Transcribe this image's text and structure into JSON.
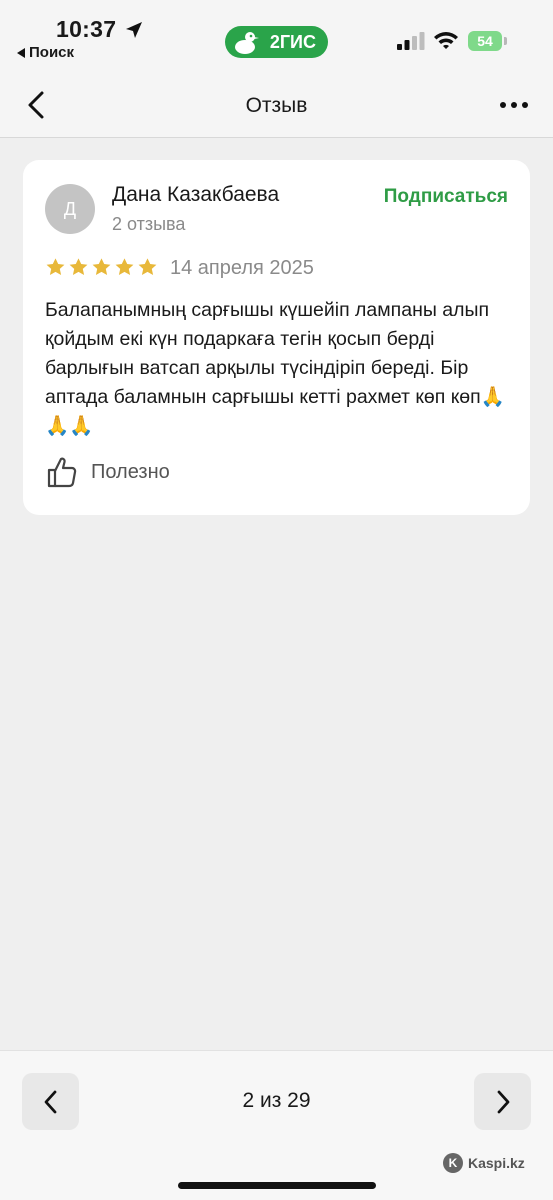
{
  "status_bar": {
    "time": "10:37",
    "back_app": "Поиск",
    "brand": "2ГИС",
    "battery": "54"
  },
  "nav": {
    "title": "Отзыв"
  },
  "review": {
    "avatar_letter": "Д",
    "author": "Дана Казакбаева",
    "review_count": "2 отзыва",
    "subscribe_label": "Подписаться",
    "rating": 5,
    "date": "14 апреля 2025",
    "text": "Балапанымның сарғышы күшейіп лампаны алып қойдым екі күн подаркаға тегін қосып берді барлығын ватсап арқылы түсіндіріп береді. Бір аптада баламнын сарғышы кетті рахмет көп көп🙏🙏🙏",
    "useful_label": "Полезно"
  },
  "pager": {
    "label": "2 из 29"
  },
  "watermark": {
    "text": "Kaspi.kz"
  },
  "colors": {
    "accent_green": "#2f9c46",
    "brand_green": "#2aa44a",
    "star_gold": "#e8b83a",
    "battery_green": "#7fd98a"
  },
  "icons": [
    "location-arrow-icon",
    "signal-icon",
    "wifi-icon",
    "chevron-left-icon",
    "more-dots-icon",
    "star-icon",
    "thumbs-up-icon",
    "chevron-right-icon"
  ]
}
